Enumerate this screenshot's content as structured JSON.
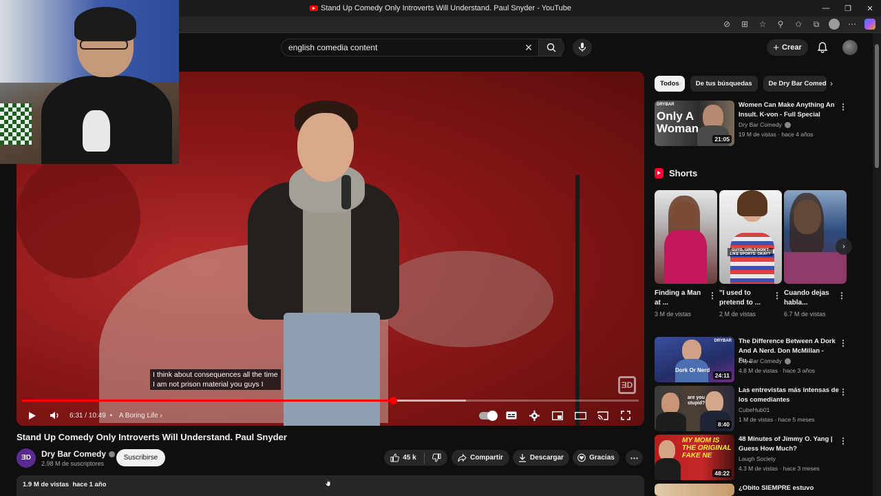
{
  "window": {
    "title": "Stand Up Comedy Only Introverts Will Understand. Paul Snyder - YouTube",
    "controls": [
      "—",
      "❐",
      "✕"
    ]
  },
  "search": {
    "query": "english comedia content"
  },
  "header": {
    "create_label": "Crear"
  },
  "player": {
    "subtitle_line1": "I think about consequences all the time",
    "subtitle_line2": "I am not prison material you guys I",
    "time": "6:31 / 10:49",
    "chapter": "A Boring Life",
    "progress_fraction": 0.602,
    "buffered_fraction": 0.72,
    "watermark": "ƎD"
  },
  "video": {
    "title": "Stand Up Comedy Only Introverts Will Understand. Paul Snyder",
    "channel_name": "Dry Bar Comedy",
    "channel_avatar_text": "ƎD",
    "subscribers": "2.98 M de suscriptores",
    "subscribe_label": "Suscribirse",
    "likes": "45 k",
    "share_label": "Compartir",
    "download_label": "Descargar",
    "thanks_label": "Gracias",
    "views_date": "1.9 M de vistas  hace 1 año"
  },
  "chips": [
    "Todos",
    "De tus búsquedas",
    "De Dry Bar Comedy"
  ],
  "top_rec": {
    "thumb_text_line1": "Only A",
    "thumb_text_line2": "Woman",
    "thumb_badge": "DRYBAR",
    "duration": "21:05",
    "title": "Women Can Make Anything An Insult. K-von - Full Special",
    "channel": "Dry Bar Comedy",
    "meta": "19 M de vistas · hace 4 años"
  },
  "shorts": {
    "heading": "Shorts",
    "items": [
      {
        "title": "Finding a Man at ...",
        "views": "3 M de vistas",
        "overlay": ""
      },
      {
        "title": "\"I used to pretend to ...",
        "views": "2 M de vistas",
        "overlay": "GUYS, GIRLS DON'T LIKE SPORTS. OKAY?"
      },
      {
        "title": "Cuando dejas habla...",
        "views": "6.7 M de vistas",
        "overlay": ""
      }
    ]
  },
  "recs": [
    {
      "title": "The Difference Between A Dork And A Nerd. Don McMillan - Fu...",
      "channel": "Dry Bar Comedy",
      "verified": true,
      "meta": "4.8 M de vistas · hace 3 años",
      "duration": "24:11",
      "thumb_text": "Dork Or Nerd",
      "thumb_badge": "DRYBAR"
    },
    {
      "title": "Las entrevistas más intensas de los comediantes",
      "channel": "CubeHub01",
      "verified": false,
      "meta": "1 M de vistas · hace 5 meses",
      "duration": "8:40",
      "thumb_text": "are you stupid?",
      "thumb_badge": ""
    },
    {
      "title": "48 Minutes of Jimmy O. Yang | Guess How Much?",
      "channel": "Laugh Society",
      "verified": false,
      "meta": "4.3 M de vistas · hace 3 meses",
      "duration": "48:22",
      "thumb_text": "MY MOM IS THE ORIGINAL FAKE NE",
      "thumb_badge": ""
    },
    {
      "title": "¿Obito SIEMPRE estuvo",
      "channel": "",
      "verified": false,
      "meta": "",
      "duration": "",
      "thumb_text": "",
      "thumb_badge": ""
    }
  ],
  "colors": {
    "accent": "#ff0000",
    "bg": "#0f0f0f",
    "chip_active": "#f1f1f1"
  }
}
